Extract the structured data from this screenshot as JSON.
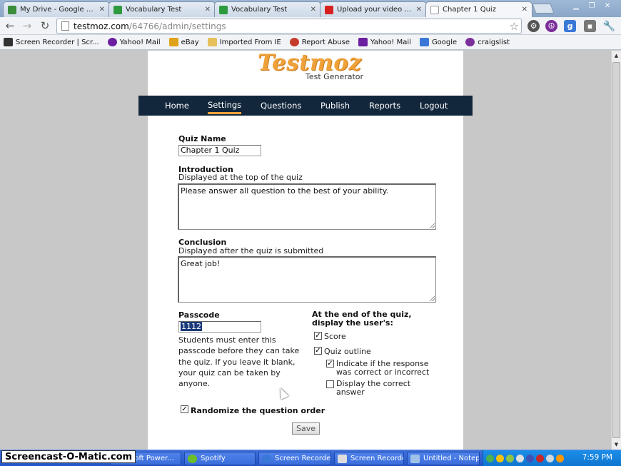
{
  "browser": {
    "tabs": [
      {
        "label": "My Drive - Google Drive",
        "icon_color": "#3b8e3b"
      },
      {
        "label": "Vocabulary Test",
        "icon_color": "#2e9a3e"
      },
      {
        "label": "Vocabulary Test",
        "icon_color": "#2e9a3e"
      },
      {
        "label": "Upload your video - YouTu",
        "icon_color": "#d62020"
      },
      {
        "label": "Chapter 1 Quiz",
        "icon_color": "#ffffff"
      }
    ],
    "url_host": "testmoz.com",
    "url_path": "/64766/admin/settings",
    "bookmarks": [
      {
        "label": "Screen Recorder | Scr...",
        "icon_color": "#333333"
      },
      {
        "label": "Yahoo! Mail",
        "icon_color": "#6b1fa0"
      },
      {
        "label": "eBay",
        "icon_color": "#e0a21a"
      },
      {
        "label": "Imported From IE",
        "icon_color": "#e6c05a"
      },
      {
        "label": "Report Abuse",
        "icon_color": "#c53b2a"
      },
      {
        "label": "Yahoo! Mail",
        "icon_color": "#6b1fa0"
      },
      {
        "label": "Google",
        "icon_color": "#3a78d8"
      },
      {
        "label": "craigslist",
        "icon_color": "#7b2f9a"
      }
    ]
  },
  "site": {
    "logo": "Testmoz",
    "logo_sub": "Test Generator",
    "nav": [
      "Home",
      "Settings",
      "Questions",
      "Publish",
      "Reports",
      "Logout"
    ],
    "nav_current": "Settings",
    "accent_color": "#f0a23a",
    "nav_color": "#13273c"
  },
  "form": {
    "quiz_name_label": "Quiz Name",
    "quiz_name_value": "Chapter 1 Quiz",
    "intro_label": "Introduction",
    "intro_help": "Displayed at the top of the quiz",
    "intro_value": "Please answer all question to the best of your ability.",
    "conclusion_label": "Conclusion",
    "conclusion_help": "Displayed after the quiz is submitted",
    "conclusion_value": "Great job!",
    "passcode_label": "Passcode",
    "passcode_value": "1112",
    "passcode_help": "Students must enter this passcode before they can take the quiz. If you leave it blank, your quiz can be taken by anyone.",
    "display_label": "At the end of the quiz, display the user's:",
    "options": {
      "score": {
        "label": "Score",
        "checked": true
      },
      "outline": {
        "label": "Quiz outline",
        "checked": true
      },
      "indicate": {
        "label": "Indicate if the response was correct or incorrect",
        "checked": true
      },
      "correct": {
        "label": "Display the correct answer",
        "checked": false
      }
    },
    "randomize_label": "Randomize the question order",
    "randomize_checked": true,
    "save_label": "Save"
  },
  "taskbar": {
    "watermark": "Screencast-O-Matic.com",
    "items": [
      {
        "label": "osoft Power...",
        "icon_color": "#d2572b"
      },
      {
        "label": "Spotify",
        "icon_color": "#6cbf2a"
      },
      {
        "label": "Screen Recorder...",
        "icon_color": "#3a78d8"
      },
      {
        "label": "Screen Recorder",
        "icon_color": "#dddddd"
      },
      {
        "label": "Untitled - Notepad",
        "icon_color": "#9fc3e8"
      }
    ],
    "clock": "7:59 PM"
  }
}
